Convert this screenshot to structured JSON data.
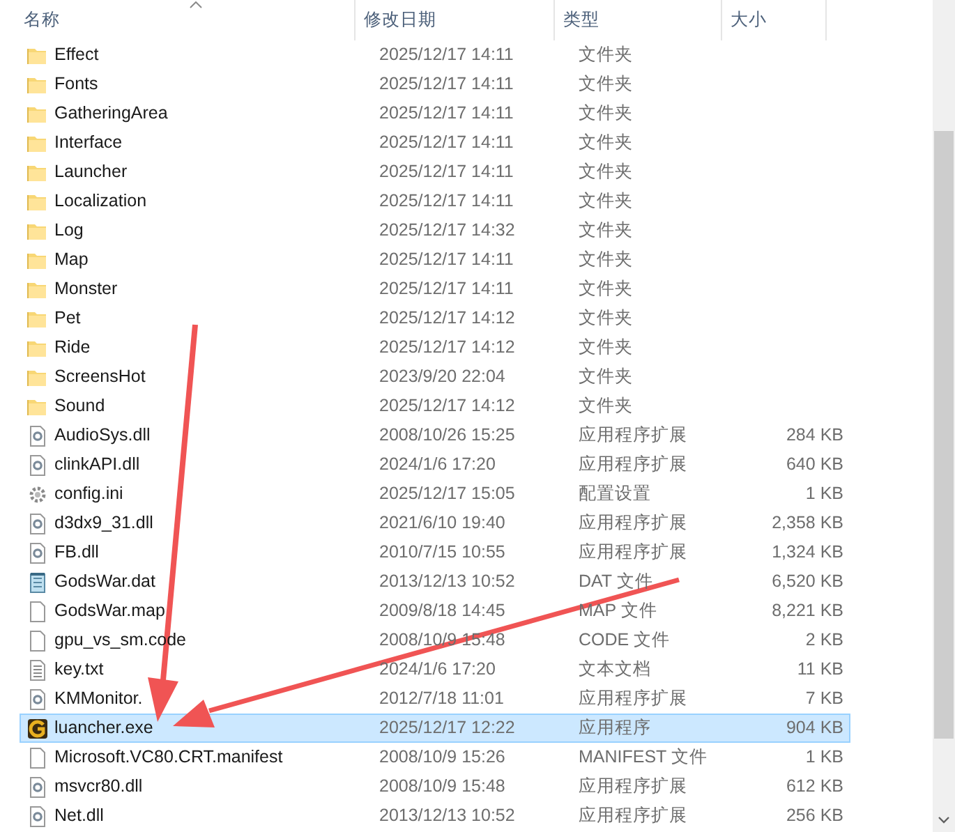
{
  "columns": [
    {
      "label": "名称",
      "sorted": true
    },
    {
      "label": "修改日期",
      "sorted": false
    },
    {
      "label": "类型",
      "sorted": false
    },
    {
      "label": "大小",
      "sorted": false
    }
  ],
  "rows": [
    {
      "kind": "folder",
      "name": "Effect",
      "date": "2025/12/17 14:11",
      "type": "文件夹",
      "selected": false
    },
    {
      "kind": "folder",
      "name": "Fonts",
      "date": "2025/12/17 14:11",
      "type": "文件夹",
      "selected": false
    },
    {
      "kind": "folder",
      "name": "GatheringArea",
      "date": "2025/12/17 14:11",
      "type": "文件夹",
      "selected": false
    },
    {
      "kind": "folder",
      "name": "Interface",
      "date": "2025/12/17 14:11",
      "type": "文件夹",
      "selected": false
    },
    {
      "kind": "folder",
      "name": "Launcher",
      "date": "2025/12/17 14:11",
      "type": "文件夹",
      "selected": false
    },
    {
      "kind": "folder",
      "name": "Localization",
      "date": "2025/12/17 14:11",
      "type": "文件夹",
      "selected": false
    },
    {
      "kind": "folder",
      "name": "Log",
      "date": "2025/12/17 14:32",
      "type": "文件夹",
      "selected": false
    },
    {
      "kind": "folder",
      "name": "Map",
      "date": "2025/12/17 14:11",
      "type": "文件夹",
      "selected": false
    },
    {
      "kind": "folder",
      "name": "Monster",
      "date": "2025/12/17 14:11",
      "type": "文件夹",
      "selected": false
    },
    {
      "kind": "folder",
      "name": "Pet",
      "date": "2025/12/17 14:12",
      "type": "文件夹",
      "selected": false
    },
    {
      "kind": "folder",
      "name": "Ride",
      "date": "2025/12/17 14:12",
      "type": "文件夹",
      "selected": false
    },
    {
      "kind": "folder",
      "name": "ScreensHot",
      "date": "2023/9/20 22:04",
      "type": "文件夹",
      "selected": false
    },
    {
      "kind": "folder",
      "name": "Sound",
      "date": "2025/12/17 14:12",
      "type": "文件夹",
      "selected": false
    },
    {
      "kind": "dll",
      "name": "AudioSys.dll",
      "date": "2008/10/26 15:25",
      "type": "应用程序扩展",
      "size": "284 KB",
      "selected": false
    },
    {
      "kind": "dll",
      "name": "clinkAPI.dll",
      "date": "2024/1/6 17:20",
      "type": "应用程序扩展",
      "size": "640 KB",
      "selected": false
    },
    {
      "kind": "ini",
      "name": "config.ini",
      "date": "2025/12/17 15:05",
      "type": "配置设置",
      "size": "1 KB",
      "selected": false
    },
    {
      "kind": "dll",
      "name": "d3dx9_31.dll",
      "date": "2021/6/10 19:40",
      "type": "应用程序扩展",
      "size": "2,358 KB",
      "selected": false
    },
    {
      "kind": "dll",
      "name": "FB.dll",
      "date": "2010/7/15 10:55",
      "type": "应用程序扩展",
      "size": "1,324 KB",
      "selected": false
    },
    {
      "kind": "dat",
      "name": "GodsWar.dat",
      "date": "2013/12/13 10:52",
      "type": "DAT 文件",
      "size": "6,520 KB",
      "selected": false
    },
    {
      "kind": "file",
      "name": "GodsWar.map",
      "date": "2009/8/18 14:45",
      "type": "MAP 文件",
      "size": "8,221 KB",
      "selected": false
    },
    {
      "kind": "file",
      "name": "gpu_vs_sm.code",
      "date": "2008/10/9 15:48",
      "type": "CODE 文件",
      "size": "2 KB",
      "selected": false
    },
    {
      "kind": "txt",
      "name": "key.txt",
      "date": "2024/1/6 17:20",
      "type": "文本文档",
      "size": "11 KB",
      "selected": false
    },
    {
      "kind": "dll",
      "name": "KMMonitor.",
      "date": "2012/7/18 11:01",
      "type": "应用程序扩展",
      "size": "7 KB",
      "selected": false
    },
    {
      "kind": "exe",
      "name": "luancher.exe",
      "date": "2025/12/17 12:22",
      "type": "应用程序",
      "size": "904 KB",
      "selected": true
    },
    {
      "kind": "file",
      "name": "Microsoft.VC80.CRT.manifest",
      "date": "2008/10/9 15:26",
      "type": "MANIFEST 文件",
      "size": "1 KB",
      "selected": false
    },
    {
      "kind": "dll",
      "name": "msvcr80.dll",
      "date": "2008/10/9 15:48",
      "type": "应用程序扩展",
      "size": "612 KB",
      "selected": false
    },
    {
      "kind": "dll",
      "name": "Net.dll",
      "date": "2013/12/13 10:52",
      "type": "应用程序扩展",
      "size": "256 KB",
      "selected": false
    }
  ]
}
